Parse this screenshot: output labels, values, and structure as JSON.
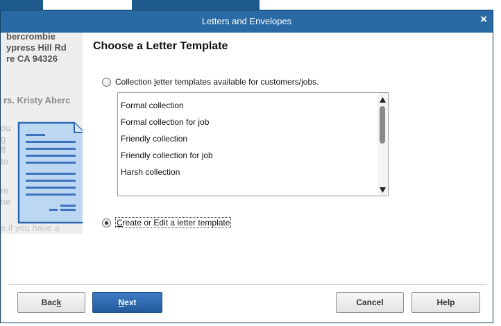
{
  "window": {
    "title": "Letters and Envelopes",
    "close_symbol": "×"
  },
  "side_panel": {
    "address_lines": [
      "bercrombie",
      "ypress Hill Rd",
      "re CA 94326"
    ],
    "greeting": "rs. Kristy Aberc",
    "body_fragments": [
      "ou",
      "g",
      "ff",
      "to",
      "re",
      "ne"
    ],
    "closing_line": "e if you have a"
  },
  "main": {
    "heading": "Choose a Letter Template",
    "option_collection": {
      "label_before": "Collection ",
      "label_underlined": "l",
      "label_after": "etter templates available for customers/jobs.",
      "checked": false
    },
    "templates": [
      "Formal collection",
      "Formal collection for job",
      "Friendly collection",
      "Friendly collection for job",
      "Harsh collection"
    ],
    "option_create": {
      "label_underlined": "C",
      "label_after": "reate or Edit a letter template",
      "checked": true
    }
  },
  "footer": {
    "back": {
      "before": "Bac",
      "underlined": "k"
    },
    "next": {
      "underlined": "N",
      "after": "ext"
    },
    "cancel": "Cancel",
    "help": "Help"
  },
  "colors": {
    "titlebar": "#2a6aa4",
    "primary_button": "#2f6db5",
    "panel_background": "#eeeeee"
  },
  "icons": {
    "close": "close-icon",
    "document": "letter-document-icon",
    "scroll_up": "scroll-up-arrow-icon",
    "scroll_down": "scroll-down-arrow-icon"
  }
}
